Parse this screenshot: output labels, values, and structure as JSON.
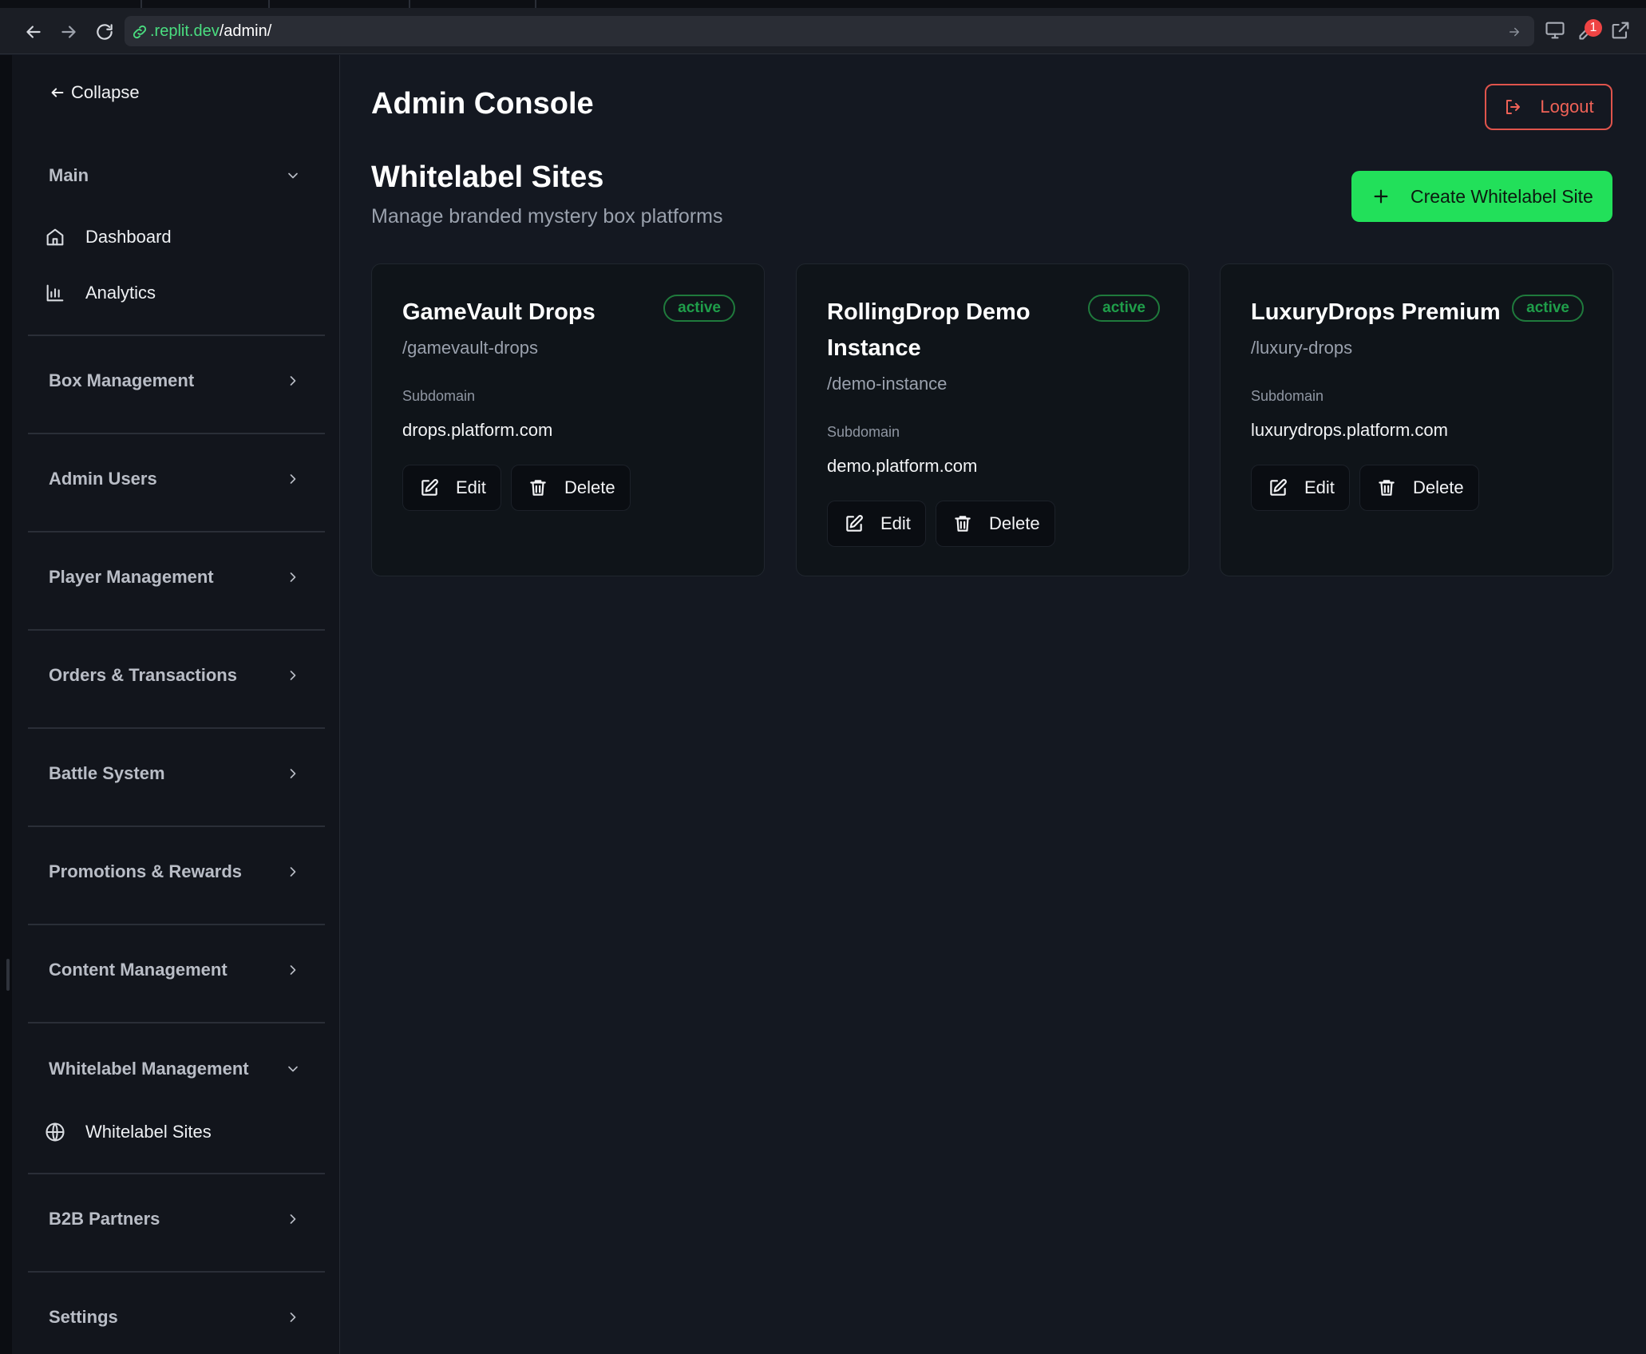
{
  "browser": {
    "url_host": ".replit.dev",
    "url_path": "/admin/",
    "notification_count": "1"
  },
  "sidebar": {
    "collapse_label": "Collapse",
    "sections": [
      {
        "label": "Main",
        "expanded": true,
        "items": [
          {
            "label": "Dashboard",
            "icon": "home-icon"
          },
          {
            "label": "Analytics",
            "icon": "bar-chart-icon"
          }
        ]
      },
      {
        "label": "Box Management",
        "expanded": false
      },
      {
        "label": "Admin Users",
        "expanded": false
      },
      {
        "label": "Player Management",
        "expanded": false
      },
      {
        "label": "Orders & Transactions",
        "expanded": false
      },
      {
        "label": "Battle System",
        "expanded": false
      },
      {
        "label": "Promotions & Rewards",
        "expanded": false
      },
      {
        "label": "Content Management",
        "expanded": false
      },
      {
        "label": "Whitelabel Management",
        "expanded": true,
        "items": [
          {
            "label": "Whitelabel Sites",
            "icon": "globe-icon"
          }
        ]
      },
      {
        "label": "B2B Partners",
        "expanded": false
      },
      {
        "label": "Settings",
        "expanded": false
      }
    ]
  },
  "header": {
    "title": "Admin Console",
    "logout_label": "Logout"
  },
  "main": {
    "title": "Whitelabel Sites",
    "subtitle": "Manage branded mystery box platforms",
    "create_label": "Create Whitelabel Site",
    "subdomain_label": "Subdomain",
    "edit_label": "Edit",
    "delete_label": "Delete",
    "sites": [
      {
        "name": "GameVault Drops",
        "status": "active",
        "slug": "/gamevault-drops",
        "subdomain": "drops.platform.com"
      },
      {
        "name": "RollingDrop Demo Instance",
        "status": "active",
        "slug": "/demo-instance",
        "subdomain": "demo.platform.com"
      },
      {
        "name": "LuxuryDrops Premium",
        "status": "active",
        "slug": "/luxury-drops",
        "subdomain": "luxurydrops.platform.com"
      }
    ]
  },
  "colors": {
    "background": "#141821",
    "accent_green": "#22e05a",
    "danger_red": "#e0544c",
    "status_green": "#1f9e4a"
  }
}
